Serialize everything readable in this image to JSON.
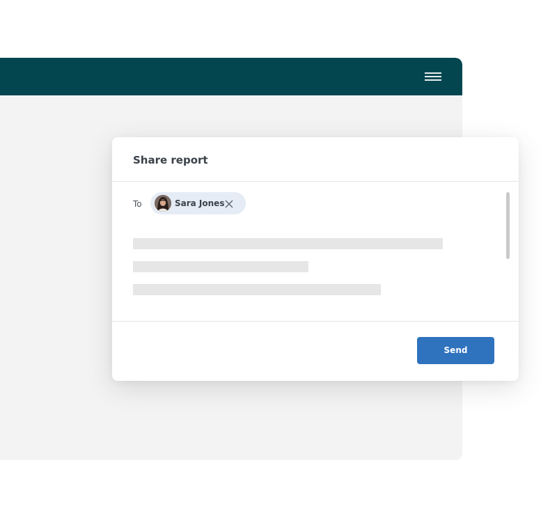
{
  "colors": {
    "header": "#034650",
    "app_background": "#f3f3f3",
    "primary": "#2f72bd",
    "chip_background": "#e5ecf5",
    "skeleton": "#e6e6e6"
  },
  "app": {
    "menu_icon": "hamburger-menu-icon"
  },
  "dialog": {
    "title": "Share report",
    "to_label": "To",
    "recipient": {
      "name": "Sara Jones",
      "avatar_icon": "user-avatar",
      "remove_icon": "close-icon"
    },
    "send_label": "Send"
  }
}
